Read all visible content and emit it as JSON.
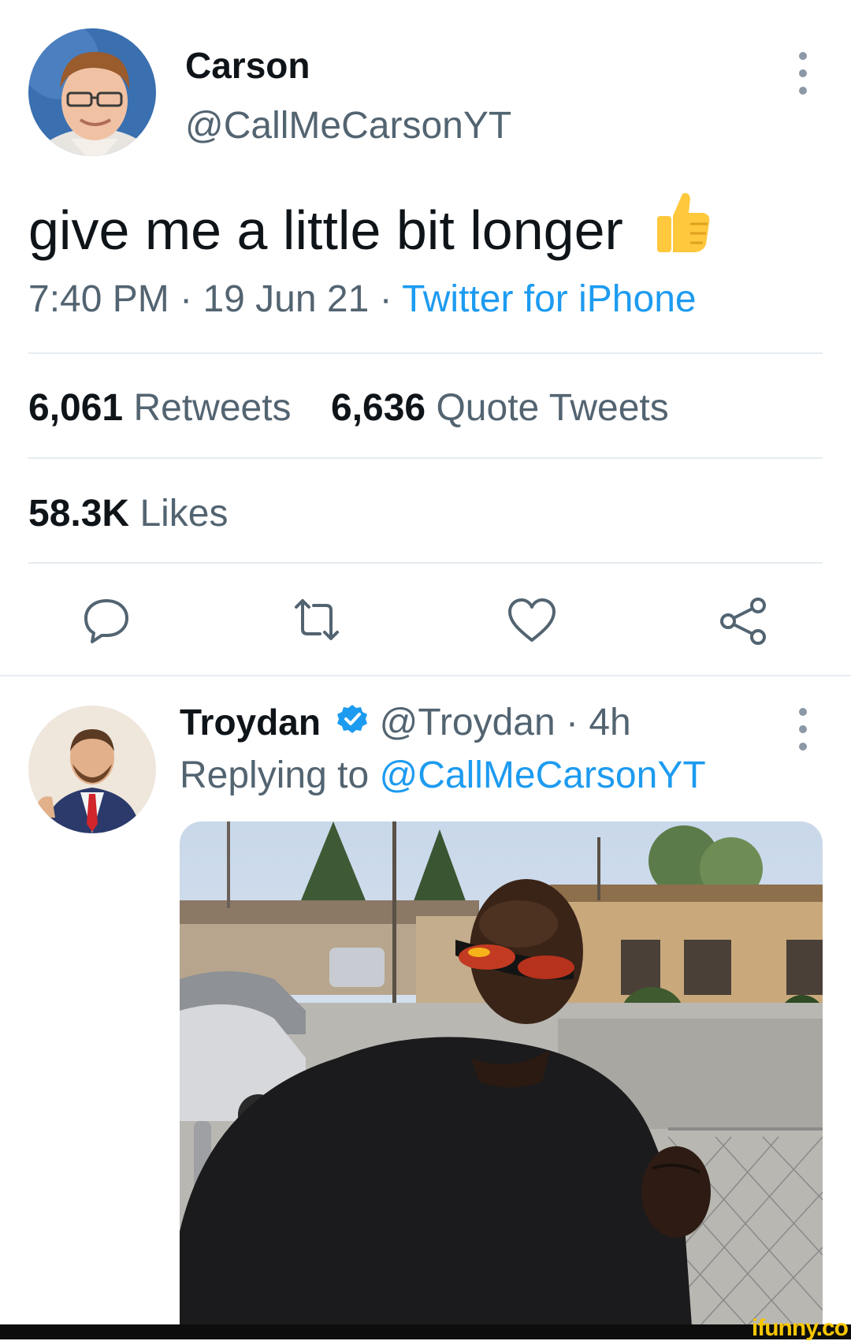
{
  "tweet": {
    "display_name": "Carson",
    "handle": "@CallMeCarsonYT",
    "text": "give me a little bit longer",
    "emoji": "👍",
    "time": "7:40 PM",
    "sep": "·",
    "date": "19 Jun 21",
    "app": "Twitter for iPhone",
    "stats": {
      "retweets_count": "6,061",
      "retweets_label": "Retweets",
      "quotes_count": "6,636",
      "quotes_label": "Quote Tweets",
      "likes_count": "58.3K",
      "likes_label": "Likes"
    },
    "actions": [
      "reply-icon",
      "retweet-icon",
      "like-icon",
      "share-icon"
    ]
  },
  "reply": {
    "display_name": "Troydan",
    "handle": "@Troydan",
    "sep": "·",
    "age": "4h",
    "replying_prefix": "Replying to",
    "replying_to": "@CallMeCarsonYT"
  },
  "watermark": "ifunny.co",
  "colors": {
    "link": "#1d9bf0",
    "muted": "#536471",
    "divider": "#e6ecf0",
    "verified": "#1d9bf0",
    "thumb": "#ffc83d"
  }
}
